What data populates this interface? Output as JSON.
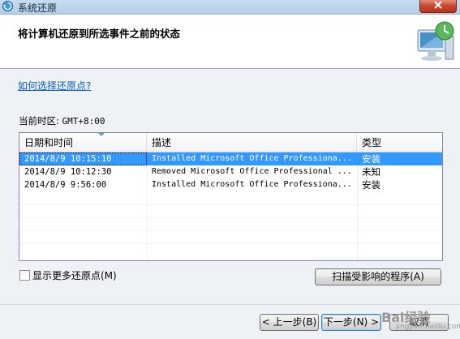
{
  "window": {
    "title": "系统还原"
  },
  "header": {
    "title": "将计算机还原到所选事件之前的状态"
  },
  "help_link": "如何选择还原点?",
  "timezone": {
    "label": "当前时区:",
    "value": "GMT+8:00"
  },
  "table": {
    "columns": [
      "日期和时间",
      "描述",
      "类型"
    ],
    "rows": [
      {
        "datetime": "2014/8/9 10:15:10",
        "description": "Installed Microsoft Office Professiona...",
        "type": "安装",
        "selected": true
      },
      {
        "datetime": "2014/8/9 10:12:30",
        "description": "Removed Microsoft Office Professional ...",
        "type": "未知",
        "selected": false
      },
      {
        "datetime": "2014/8/9 9:56:00",
        "description": "Installed Microsoft Office Professiona...",
        "type": "安装",
        "selected": false
      }
    ]
  },
  "show_more": {
    "label": "显示更多还原点(M)",
    "checked": false
  },
  "buttons": {
    "scan": "扫描受影响的程序(A)",
    "back": "< 上一步(B)",
    "next": "下一步(N) >",
    "cancel": "取消"
  },
  "watermark": {
    "text": "Bai经验",
    "sub": "jingyan.baidu.com"
  },
  "colors": {
    "selection": "#3399ff",
    "link": "#0b5bb5",
    "close_button": "#c7452b"
  },
  "icons": {
    "app": "system-restore-icon",
    "header": "computer-restore-icon"
  }
}
